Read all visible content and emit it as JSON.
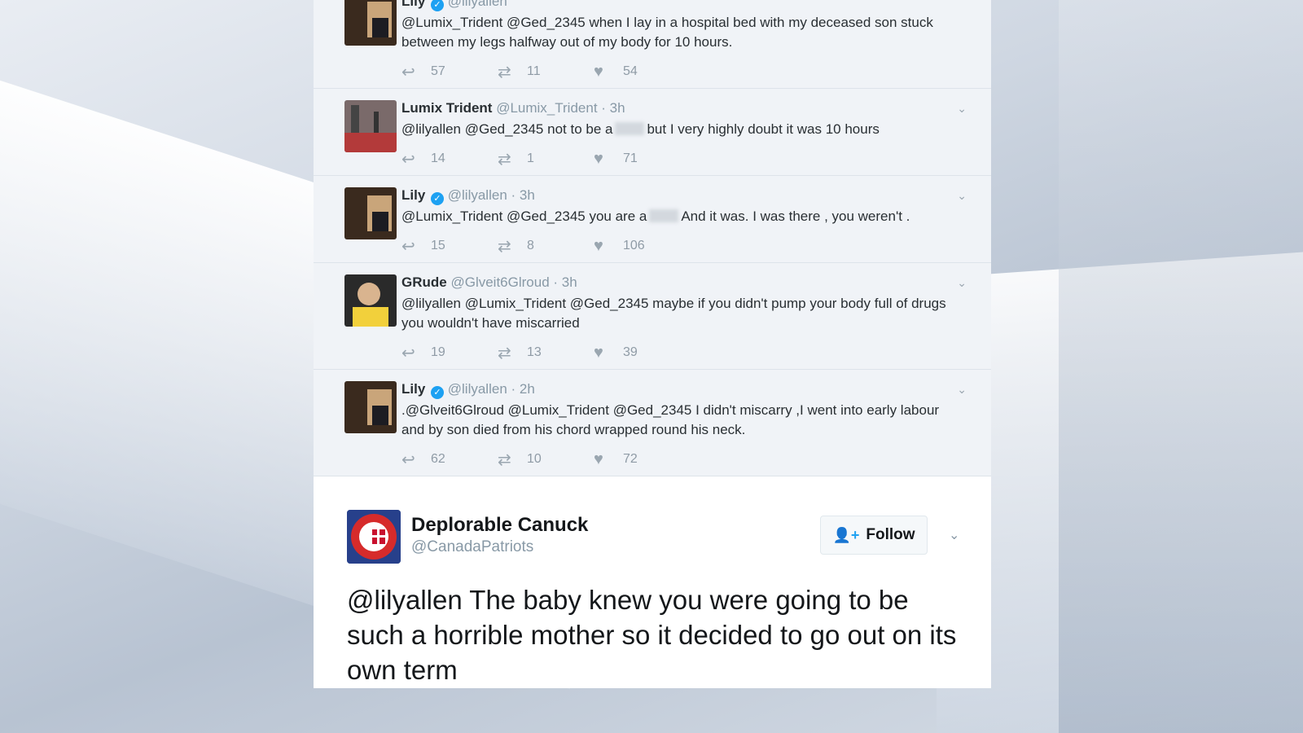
{
  "thread": [
    {
      "name": "Lily",
      "handle": "@lilyallen",
      "time": "",
      "verified": true,
      "text": "@Lumix_Trident @Ged_2345 when I lay in a hospital bed with my deceased son stuck between my legs halfway out of my body for 10 hours.",
      "replies": "57",
      "retweets": "11",
      "likes": "54"
    },
    {
      "name": "Lumix Trident",
      "handle": "@Lumix_Trident",
      "time": "· 3h",
      "verified": false,
      "text_before": "@lilyallen @Ged_2345 not to be a",
      "text_after": "but I very highly doubt it was 10 hours",
      "replies": "14",
      "retweets": "1",
      "likes": "71"
    },
    {
      "name": "Lily",
      "handle": "@lilyallen",
      "time": "· 3h",
      "verified": true,
      "text_before": "@Lumix_Trident @Ged_2345 you are a",
      "text_after": "And it was. I was there , you weren't .",
      "replies": "15",
      "retweets": "8",
      "likes": "106"
    },
    {
      "name": "GRude",
      "handle": "@Glveit6Glroud",
      "time": "· 3h",
      "verified": false,
      "text": "@lilyallen @Lumix_Trident @Ged_2345 maybe if you didn't pump your body full of drugs you wouldn't have miscarried",
      "replies": "19",
      "retweets": "13",
      "likes": "39"
    },
    {
      "name": "Lily",
      "handle": "@lilyallen",
      "time": "· 2h",
      "verified": true,
      "text": ".@Glveit6Glroud @Lumix_Trident @Ged_2345 I didn't miscarry ,I went into early labour and by son died from his chord wrapped round his neck.",
      "replies": "62",
      "retweets": "10",
      "likes": "72"
    }
  ],
  "embed": {
    "name": "Deplorable Canuck",
    "handle": "@CanadaPatriots",
    "follow_label": "Follow",
    "mention": "@lilyallen",
    "text": " The baby knew you were going to be such a horrible mother so it decided to go out on its own term"
  },
  "icons": {
    "reply": "reply-icon",
    "retweet": "retweet-icon",
    "like": "heart-icon",
    "chevron": "chevron-down-icon",
    "verified": "verified-badge-icon",
    "follow": "add-user-icon"
  },
  "colors": {
    "accent": "#1da1f2",
    "thread_bg": "#f0f3f7",
    "text": "#292f33",
    "muted": "#8899a6"
  }
}
